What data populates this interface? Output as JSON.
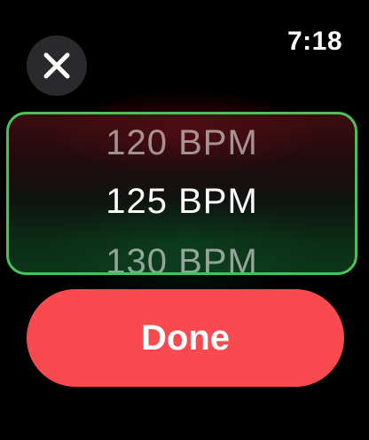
{
  "status_bar": {
    "time": "7:18"
  },
  "close_button": {
    "icon": "close-icon"
  },
  "picker": {
    "previous": "120 BPM",
    "selected": "125 BPM",
    "next": "130 BPM",
    "border_color": "#4ac25a"
  },
  "done_button": {
    "label": "Done",
    "color": "#fb4a4f"
  }
}
